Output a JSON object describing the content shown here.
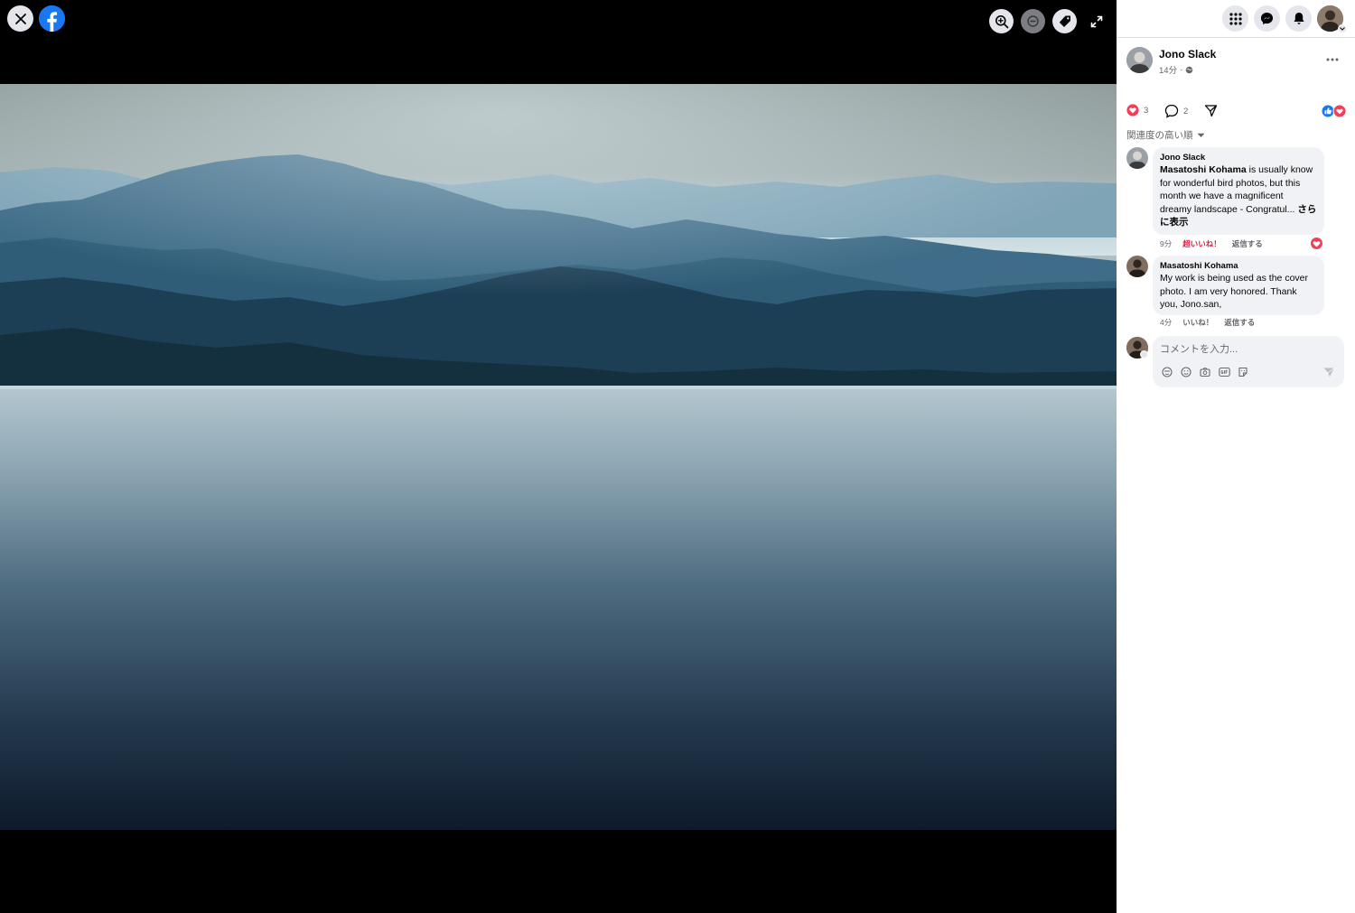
{
  "viewer": {
    "photo_alt": "",
    "controls": {
      "close": "close-icon",
      "logo": "facebook-logo-icon",
      "zoom_in": "zoom-in-icon",
      "zoom_out": "zoom-out-icon",
      "tag": "tag-icon",
      "fullscreen": "fullscreen-icon"
    }
  },
  "topbar": {
    "icons": [
      "menu-grid-icon",
      "messenger-icon",
      "bell-icon",
      "account-avatar"
    ]
  },
  "post": {
    "author": "Jono Slack",
    "time": "14分",
    "separator": "·",
    "reaction_count": "3",
    "comment_count": "2"
  },
  "sort": {
    "label": "関連度の高い順"
  },
  "comments": [
    {
      "author": "Jono Slack",
      "mention": "Masatoshi Kohama",
      "text": " is usually know for wonderful bird photos, but this month we have a magnificent dreamy landscape - Congratul...",
      "see_more": " さらに表示",
      "time": "9分",
      "like_label": "超いいね！",
      "reply_label": "返信する"
    },
    {
      "author": "Masatoshi Kohama",
      "text": "My work is being used as the cover photo. I am very honored. Thank you, Jono.san,",
      "time": "4分",
      "like_label": "いいね！",
      "reply_label": "返信する"
    }
  ],
  "composer": {
    "placeholder": "コメントを入力..."
  },
  "colors": {
    "brand": "#1877f2",
    "love": "#f33e58",
    "love_text": "#e41e3f",
    "bubble": "#f0f2f5",
    "secondary_text": "#65676b"
  }
}
